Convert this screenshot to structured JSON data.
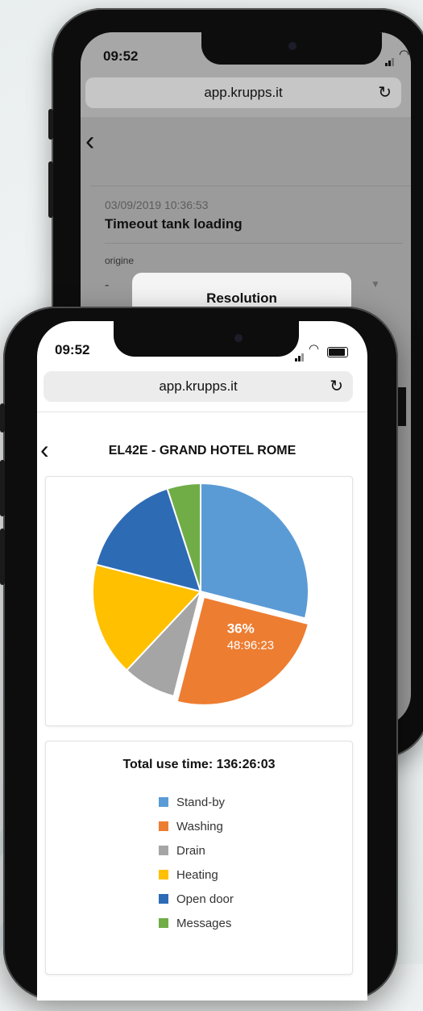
{
  "back_phone": {
    "status": {
      "time": "09:52"
    },
    "browser": {
      "url": "app.krupps.it"
    },
    "nav": {
      "back_glyph": "‹"
    },
    "event": {
      "datetime": "03/09/2019 10:36:53",
      "title": "Timeout tank loading"
    },
    "field": {
      "label": "origine",
      "value": "-"
    },
    "dialog": {
      "title": "Resolution"
    }
  },
  "front_phone": {
    "status": {
      "time": "09:52"
    },
    "browser": {
      "url": "app.krupps.it"
    },
    "header": {
      "title": "EL42E - GRAND HOTEL ROME"
    },
    "highlight": {
      "percent": "36%",
      "time": "48:96:23"
    },
    "total": {
      "label": "Total use time: 136:26:03"
    }
  },
  "chart_data": {
    "type": "pie",
    "title": "",
    "series": [
      {
        "name": "Stand-by",
        "value": 29,
        "color": "#5b9bd5"
      },
      {
        "name": "Washing",
        "value": 25,
        "color": "#ed7d31"
      },
      {
        "name": "Drain",
        "value": 8,
        "color": "#a5a5a5"
      },
      {
        "name": "Heating",
        "value": 17,
        "color": "#ffc000"
      },
      {
        "name": "Open door",
        "value": 16,
        "color": "#2e6bb5"
      },
      {
        "name": "Messages",
        "value": 5,
        "color": "#70ad47"
      }
    ]
  }
}
